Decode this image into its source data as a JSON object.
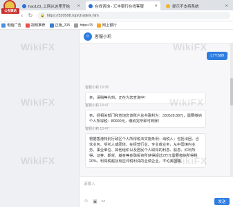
{
  "logo": {
    "ribbon_text": "公会驿站"
  },
  "tabs": [
    {
      "label": "hao123_上网从这里开始",
      "active": false
    },
    {
      "label": "在线咨询 - 汇丰银行在线客服",
      "active": true
    },
    {
      "label": "提示不支持系统",
      "active": false
    }
  ],
  "address": {
    "url": "https://330508.top/chatlink.htm"
  },
  "bookmarks": [
    "电脑广告",
    "视频推荐",
    "正版_315",
    "https://3",
    "网上银行"
  ],
  "chat": {
    "agent_name": "客服小莉",
    "user_time": "13:36",
    "user_message": "L7YS89",
    "messages": [
      {
        "meta": "客服小莉 13:38",
        "text": "亲，请稍等片刻，正在为您查询中！"
      },
      {
        "meta": "客服小莉 13:47",
        "text": "亲，经相关部门和查询您该账户总共盈利为：330528.88元，需要缴纳个人所得税：80000元，缴纳完毕即可到账！"
      },
      {
        "meta": "客服小莉 13:47",
        "text": "根据香港特别行政区个人所得税法实施条例：纳税人：包括法团、合伙业务、受托人或团体，在经营行业、专业或业务，从中国境内业务、事业单位、其他组织以及居民个人取得的利息、股息、红利所得，证券、期货、基金等金融投资所获得超过2万元需要缴纳所得税20%，利得税超及有应评税利润的业绩企业，不论美国籍。"
      }
    ],
    "input_placeholder": "请输入",
    "send_label": "发送"
  },
  "watermark": "WikiFX",
  "colors": {
    "accent": "#2e7de0",
    "brand_red": "#c9302c"
  }
}
